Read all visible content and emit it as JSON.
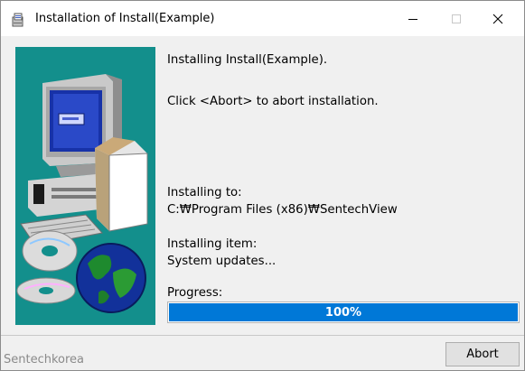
{
  "window": {
    "title": "Installation of Install(Example)"
  },
  "content": {
    "installing_line": "Installing Install(Example).",
    "abort_hint": "Click <Abort> to abort installation.",
    "installing_to_label": "Installing to:",
    "installing_to_path": "C:₩Program Files (x86)₩SentechView",
    "installing_item_label": "Installing item:",
    "installing_item_value": "System updates...",
    "progress_label": "Progress:",
    "progress_text": "100%",
    "progress_fraction": 1.0
  },
  "footer": {
    "brand": "Sentechkorea",
    "abort_label": "Abort"
  },
  "colors": {
    "side_background": "#138f8c",
    "progress_fill": "#0078d7"
  },
  "icons": {
    "app_icon": "installer-icon",
    "side_art": "computer-and-globe-illustration"
  }
}
